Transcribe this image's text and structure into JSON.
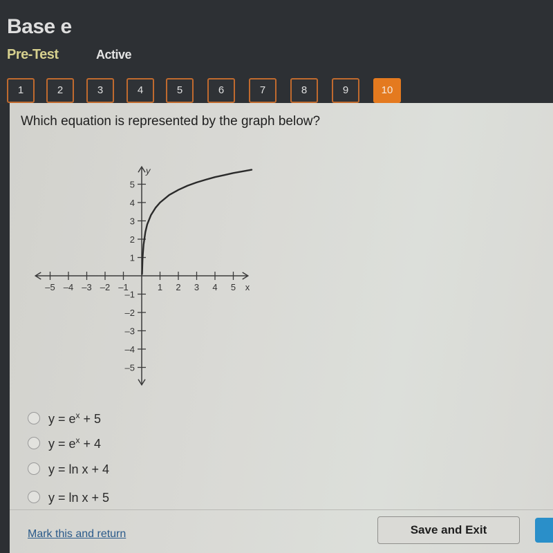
{
  "header": {
    "title": "Base e",
    "subtitle": "Pre-Test",
    "status": "Active"
  },
  "question_nav": {
    "items": [
      "1",
      "2",
      "3",
      "4",
      "5",
      "6",
      "7",
      "8",
      "9",
      "10"
    ],
    "active_index": 9
  },
  "colors": {
    "accent": "#e47a1f",
    "nav_border": "#c06a2e",
    "primary_button": "#2a8fc9",
    "link": "#2a5a8a"
  },
  "question": {
    "text": "Which equation is represented by the graph below?"
  },
  "chart_data": {
    "type": "line",
    "title": "",
    "xlabel": "x",
    "ylabel": "y",
    "xlim": [
      -5.5,
      5.5
    ],
    "ylim": [
      -5.5,
      5.5
    ],
    "x_ticks": [
      -5,
      -4,
      -3,
      -2,
      -1,
      1,
      2,
      3,
      4,
      5
    ],
    "y_ticks": [
      -5,
      -4,
      -3,
      -2,
      -1,
      1,
      2,
      3,
      4,
      5
    ],
    "x_tick_labels": [
      "-5",
      "-4",
      "-3",
      "-2",
      "-1",
      "1",
      "2",
      "3",
      "4",
      "5"
    ],
    "y_tick_labels": [
      "-5",
      "-4",
      "-3",
      "-2",
      "-1",
      "1",
      "2",
      "3",
      "4",
      "5"
    ],
    "grid": false,
    "series": [
      {
        "name": "curve",
        "function": "ln(x) + 4",
        "x": [
          0.02,
          0.05,
          0.1,
          0.2,
          0.3,
          0.5,
          0.75,
          1,
          1.5,
          2,
          2.5,
          3,
          3.5,
          4,
          4.5,
          5,
          5.5,
          6
        ],
        "y": [
          0.09,
          1.0,
          1.7,
          2.39,
          2.8,
          3.31,
          3.71,
          4.0,
          4.41,
          4.69,
          4.92,
          5.1,
          5.25,
          5.39,
          5.5,
          5.61,
          5.7,
          5.79
        ]
      }
    ]
  },
  "options": [
    {
      "prefix": "y = e",
      "sup": "x",
      "suffix": " + 5"
    },
    {
      "prefix": "y = e",
      "sup": "x",
      "suffix": " + 4"
    },
    {
      "prefix": "y = ln x + 4",
      "sup": "",
      "suffix": ""
    },
    {
      "prefix": "y = ln x + 5",
      "sup": "",
      "suffix": ""
    }
  ],
  "footer": {
    "mark_link": "Mark this and return",
    "save_exit": "Save and Exit"
  }
}
